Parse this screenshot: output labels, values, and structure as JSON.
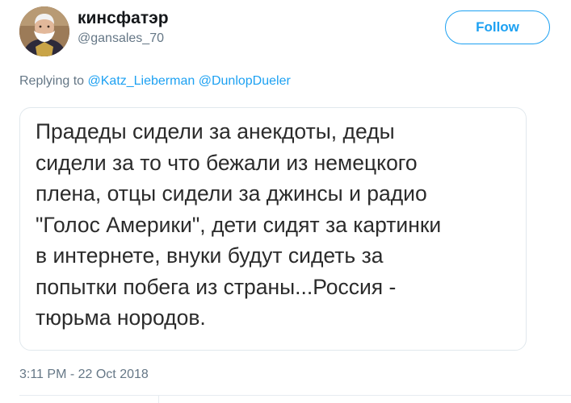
{
  "tweet": {
    "display_name": "кинсфатэр",
    "handle": "@gansales_70",
    "follow_label": "Follow",
    "replying_prefix": "Replying to",
    "reply_mentions": [
      "@Katz_Lieberman",
      "@DunlopDueler"
    ],
    "image_text_lines": [
      "Прадеды сидели за анекдоты, деды",
      "сидели за то что бежали из немецкого",
      "плена, отцы сидели за джинсы и радио",
      "\"Голос Америки\", дети сидят за картинки",
      "в интернете, внуки будут сидеть за",
      "попытки побега из страны...Россия -",
      "тюрьма нородов."
    ],
    "timestamp": "3:11 PM - 22 Oct 2018"
  },
  "colors": {
    "accent": "#1da1f2",
    "secondary_text": "#657786",
    "primary_text": "#14171a",
    "border": "#e1e8ed"
  },
  "icons": {
    "avatar": "portrait-avatar"
  }
}
